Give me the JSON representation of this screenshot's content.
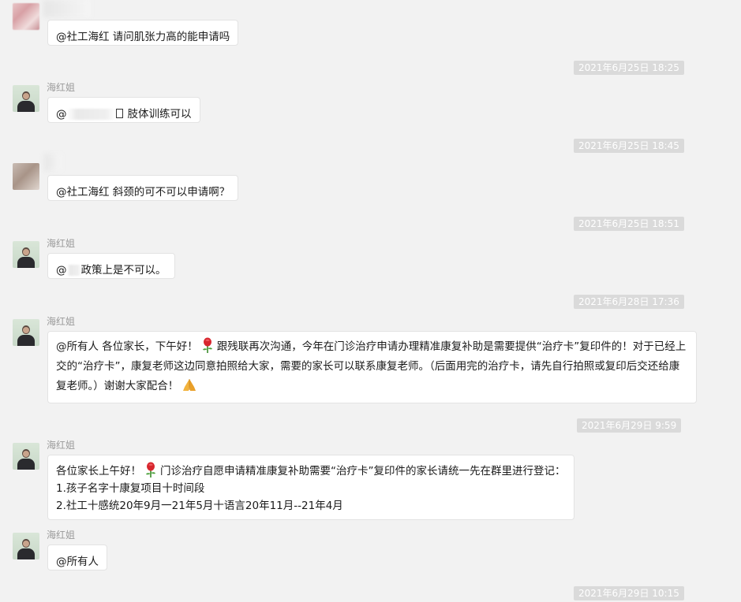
{
  "messages": [
    {
      "sender": "",
      "text": "@社工海红 请问肌张力高的能申请吗"
    },
    {
      "timestamp": "2021年6月25日 18:25"
    },
    {
      "sender": "海红姐",
      "text_prefix": "@",
      "text_suffix": "肢体训练可以"
    },
    {
      "timestamp": "2021年6月25日 18:45"
    },
    {
      "sender": "",
      "text": "@社工海红 斜颈的可不可以申请啊？"
    },
    {
      "timestamp": "2021年6月25日 18:51"
    },
    {
      "sender": "海红姐",
      "text_prefix": "@",
      "text_suffix": "政策上是不可以。"
    },
    {
      "timestamp": "2021年6月28日 17:36"
    },
    {
      "sender": "海红姐",
      "text_a": "@所有人 各位家长，下午好！",
      "text_b": "跟残联再次沟通，今年在门诊治疗申请办理精准康复补助是需要提供“治疗卡”复印件的！对于已经上交的“治疗卡”，康复老师这边同意拍照给大家，需要的家长可以联系康复老师。（后面用完的治疗卡，请先自行拍照或复印后交还给康复老师。）谢谢大家配合！"
    },
    {
      "timestamp": "2021年6月29日 9:59"
    },
    {
      "sender": "海红姐",
      "line1_a": "各位家长上午好！",
      "line1_b": "门诊治疗自愿申请精准康复补助需要“治疗卡”复印件的家长请统一先在群里进行登记：",
      "line2": "1.孩子名字十康复项目十时间段",
      "line3": "2.社工十感统20年9月一21年5月十语言20年11月--21年4月"
    },
    {
      "sender": "海红姐",
      "text": "@所有人"
    },
    {
      "timestamp": "2021年6月29日 10:15"
    }
  ],
  "icons": {
    "rose": "rose-emoji-icon",
    "hands": "folded-hands-emoji-icon"
  },
  "colors": {
    "background": "#f2f2f2",
    "bubble": "#ffffff",
    "timestamp_bg": "#dadada",
    "name": "#9a9a9a"
  }
}
